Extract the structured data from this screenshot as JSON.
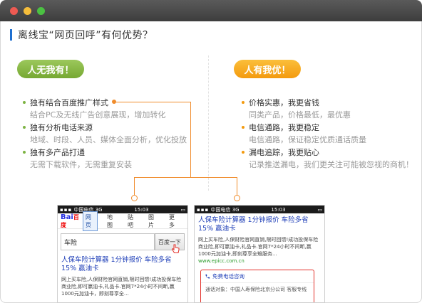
{
  "heading": "离线宝“网页回呼”有何优势？",
  "left_badge": "人无我有！",
  "right_badge": "人有我优！",
  "left_features": [
    {
      "title": "独有结合百度推广样式",
      "desc": "结合PC及无线广告创意展现，增加转化"
    },
    {
      "title": "独有分析电话来源",
      "desc": "地域、时段、人员、媒体全面分析，优化投放"
    },
    {
      "title": "独有多产品打通",
      "desc": "无需下载软件，无需重复安装"
    }
  ],
  "right_features": [
    {
      "title": "价格实惠，我更省钱",
      "desc": "同类产品，价格最低，最优惠"
    },
    {
      "title": "电信通路，我更稳定",
      "desc": "电信通路，保证稳定优质通话质量"
    },
    {
      "title": "漏电追踪，我更贴心",
      "desc": "记录推送漏电，我们更关注可能被忽视的商机！"
    }
  ],
  "phone_left": {
    "carrier": "中国电信",
    "network": "3G",
    "time": "15:03",
    "logo_a": "Bai",
    "logo_b": "百度",
    "tabs": [
      "网页",
      "地图",
      "贴吧",
      "图片",
      "更多"
    ],
    "query": "车险",
    "search_button": "百度一下",
    "result_title": "人保车险计算器 1分钟报价 车险多省15% 赢油卡",
    "result_body": "网上买车险,人保财险官网直销,限时回馈!成功投保车险商业险,即可赢油卡,礼品卡.官网7*24小时不间断,赢1000元加油卡，即刻尊享全…"
  },
  "phone_right": {
    "carrier": "中国电信",
    "network": "3G",
    "time": "15:03",
    "result_title": "人保车险计算器 1分钟报价 车险多省15% 赢油卡",
    "result_body": "网上买车险,人保财险官网直销,限时回馈!成功投保车险商业险,即可赢油卡,礼品卡.官网7*24小时不间断,赢1000元加油卡,即刻尊享全雉服务...",
    "url": "www.epicc.com.cn",
    "call_label": "免费电话咨询",
    "call_target": "通话对象：中国人寿保险北京分公司 客服专线"
  },
  "colors": {
    "accent_blue": "#1e6fd0",
    "green": "#7cb342",
    "orange": "#f39a0e",
    "connector": "#f08c2c",
    "highlight_red": "#e3302a"
  }
}
